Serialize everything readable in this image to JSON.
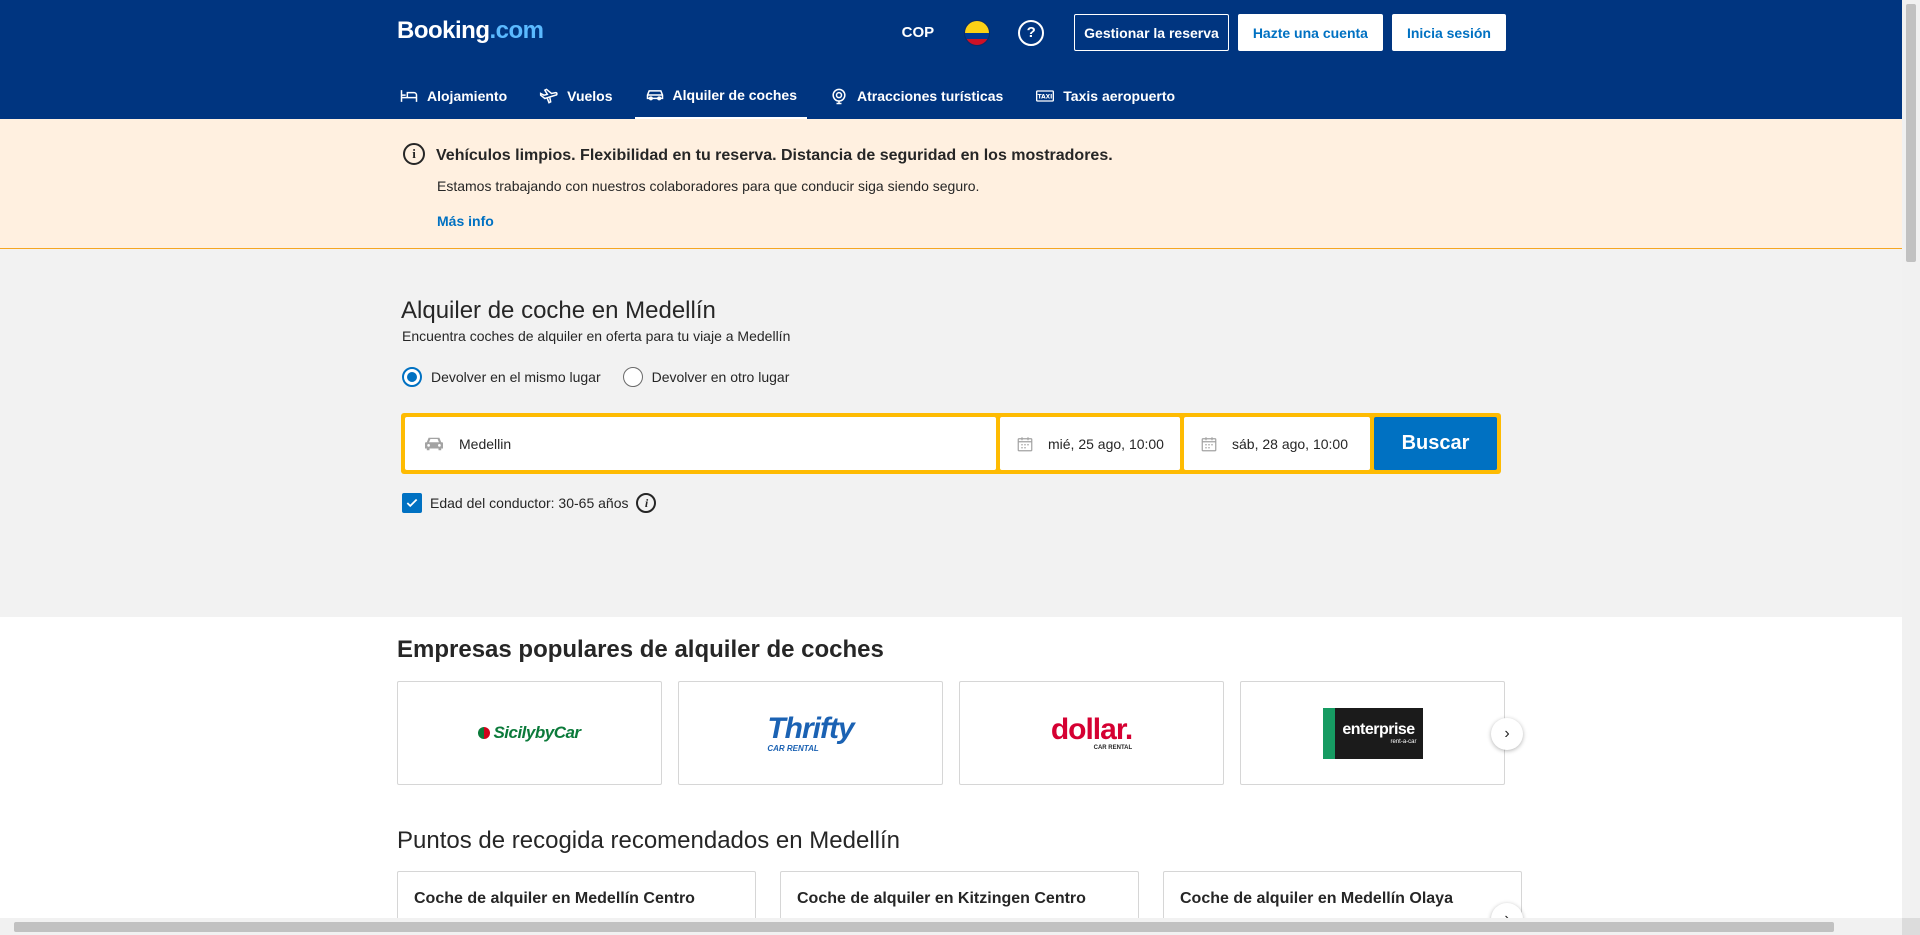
{
  "header": {
    "logo_main": "Booking",
    "logo_dot": ".com",
    "currency": "COP",
    "flag_icon": "colombia-flag-icon",
    "help_icon": "?",
    "manage_booking": "Gestionar la reserva",
    "create_account": "Hazte una cuenta",
    "sign_in": "Inicia sesión"
  },
  "nav": {
    "items": [
      {
        "label": "Alojamiento",
        "icon": "bed-icon"
      },
      {
        "label": "Vuelos",
        "icon": "plane-icon"
      },
      {
        "label": "Alquiler de coches",
        "icon": "car-icon",
        "active": true
      },
      {
        "label": "Atracciones turísticas",
        "icon": "attractions-icon"
      },
      {
        "label": "Taxis aeropuerto",
        "icon": "taxi-icon"
      }
    ]
  },
  "banner": {
    "icon": "i",
    "title": "Vehículos limpios. Flexibilidad en tu reserva. Distancia de seguridad en los mostradores.",
    "text": "Estamos trabajando con nuestros colaboradores para que conducir siga siendo seguro.",
    "link": "Más info"
  },
  "search": {
    "title": "Alquiler de coche en Medellín",
    "subtitle": "Encuentra coches de alquiler en oferta para tu viaje a Medellín",
    "radio_same": "Devolver en el mismo lugar",
    "radio_other": "Devolver en otro lugar",
    "location_value": "Medellin",
    "pickup_date": "mié, 25 ago, 10:00",
    "dropoff_date": "sáb, 28 ago, 10:00",
    "button": "Buscar",
    "age_label": "Edad del conductor: 30-65 años",
    "age_info_icon": "i"
  },
  "companies": {
    "title": "Empresas populares de alquiler de coches",
    "sicily": "SicilybyCar",
    "thrifty": "Thrifty",
    "thrifty_sub": "CAR RENTAL",
    "dollar": "dollar.",
    "dollar_sub": "CAR RENTAL",
    "enterprise": "enterprise",
    "enterprise_sub": "rent-a-car",
    "next_arrow": "›"
  },
  "pickup": {
    "title": "Puntos de recogida recomendados en Medellín",
    "cards": [
      {
        "title": "Coche de alquiler en Medellín Centro"
      },
      {
        "title": "Coche de alquiler en Kitzingen Centro"
      },
      {
        "title": "Coche de alquiler en Medellín Olaya"
      }
    ],
    "next_arrow": "›"
  },
  "colors": {
    "brand_blue": "#003580",
    "action_blue": "#0071c2",
    "search_yellow": "#febb02",
    "banner_bg": "#fff0e0"
  }
}
